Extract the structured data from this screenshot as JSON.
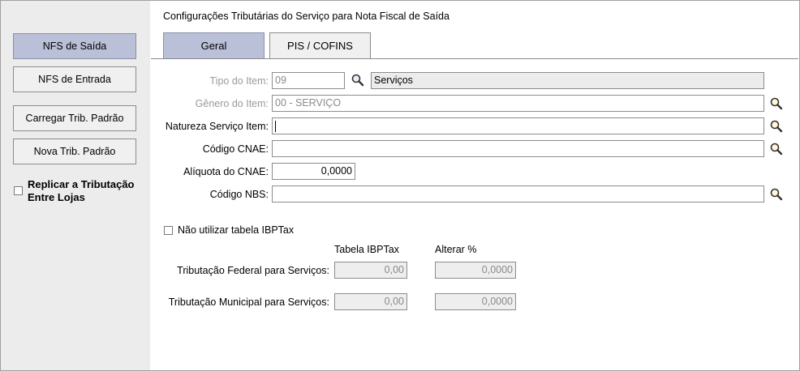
{
  "sidebar": {
    "buttons": [
      {
        "label": "NFS de Saída"
      },
      {
        "label": "NFS de Entrada"
      },
      {
        "label": "Carregar Trib. Padrão"
      },
      {
        "label": "Nova Trib. Padrão"
      }
    ],
    "replicar_label": "Replicar a Tributação Entre Lojas",
    "replicar_checked": false
  },
  "header": {
    "title": "Configurações Tributárias do Serviço para Nota Fiscal de Saída"
  },
  "tabs": [
    {
      "label": "Geral"
    },
    {
      "label": "PIS / COFINS"
    }
  ],
  "form": {
    "tipo_item": {
      "label": "Tipo do Item:",
      "code": "09",
      "description": "Serviços"
    },
    "genero_item": {
      "label": "Gênero do Item:",
      "value": "00 - SERVIÇO"
    },
    "natureza_servico": {
      "label": "Natureza Serviço Item:",
      "value": ""
    },
    "codigo_cnae": {
      "label": "Código CNAE:",
      "value": ""
    },
    "aliquota_cnae": {
      "label": "Alíquota do CNAE:",
      "value": "0,0000"
    },
    "codigo_nbs": {
      "label": "Código NBS:",
      "value": ""
    }
  },
  "ibptax": {
    "checkbox_label": "Não utilizar tabela IBPTax",
    "checked": false,
    "col_tabela": "Tabela IBPTax",
    "col_alterar": "Alterar %",
    "rows": [
      {
        "label": "Tributação Federal para Serviços:",
        "tabela": "0,00",
        "alterar": "0,0000"
      },
      {
        "label": "Tributação Municipal para Serviços:",
        "tabela": "0,00",
        "alterar": "0,0000"
      }
    ]
  },
  "icons": {
    "search": "magnifier-icon"
  },
  "colors": {
    "active_tab": "#b9c0d8",
    "sidebar_bg": "#ececec"
  }
}
